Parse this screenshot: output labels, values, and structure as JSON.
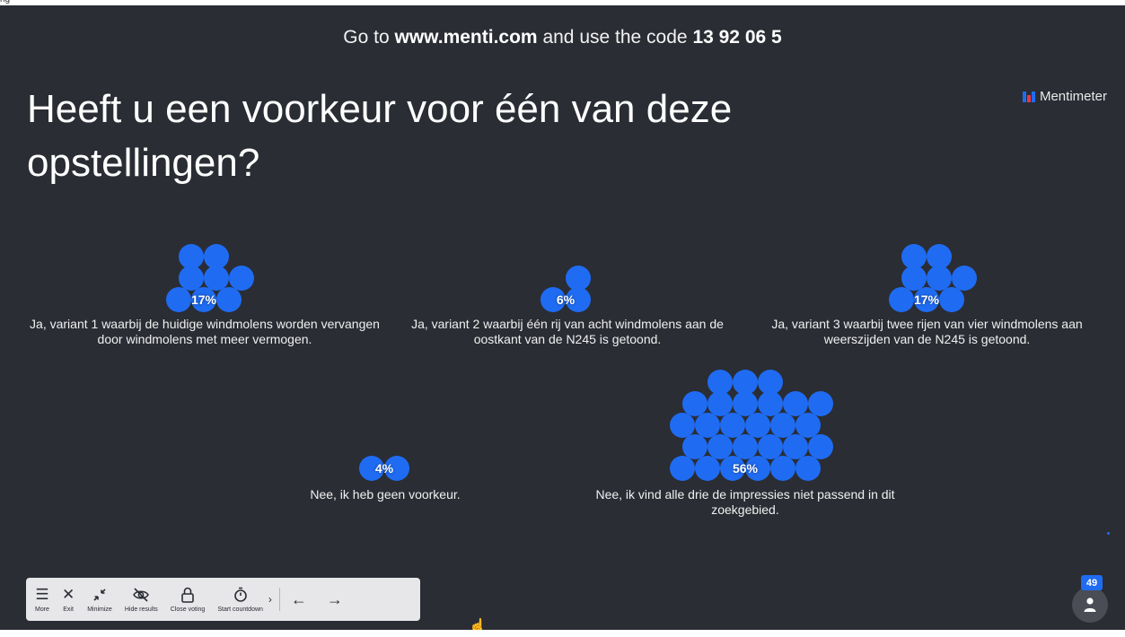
{
  "header": {
    "instruction_prefix": "Go to",
    "url": "www.menti.com",
    "instruction_middle": "and use the code",
    "code": "13 92 06 5",
    "corner_fragment": "ng"
  },
  "brand": {
    "name": "Mentimeter",
    "icon": "mentimeter-logo-icon",
    "colors": [
      "#1f6cf3",
      "#e6364a"
    ]
  },
  "question": "Heeft u een voorkeur voor één van deze opstellingen?",
  "accent_color": "#1f6cf3",
  "options": [
    {
      "label": "Ja, variant 1 waarbij de huidige windmolens worden vervangen door windmolens met meer vermogen.",
      "percent": "17%",
      "share": 0.17
    },
    {
      "label": "Ja, variant 2 waarbij één rij van acht windmolens aan de oostkant van de N245 is getoond.",
      "percent": "6%",
      "share": 0.06
    },
    {
      "label": "Ja, variant 3 waarbij twee rijen van vier windmolens aan weerszijden van de N245 is getoond.",
      "percent": "17%",
      "share": 0.17
    },
    {
      "label": "Nee, ik heb geen voorkeur.",
      "percent": "4%",
      "share": 0.04
    },
    {
      "label": "Nee, ik vind alle drie de impressies niet passend in dit zoekgebied.",
      "percent": "56%",
      "share": 0.56
    }
  ],
  "toolbar": {
    "items": [
      {
        "label": "More",
        "icon": "menu-icon"
      },
      {
        "label": "Exit",
        "icon": "close-icon"
      },
      {
        "label": "Minimize",
        "icon": "minimize-icon"
      },
      {
        "label": "Hide results",
        "icon": "eye-off-icon"
      },
      {
        "label": "Close voting",
        "icon": "lock-icon"
      },
      {
        "label": "Start countdown",
        "icon": "timer-icon"
      }
    ],
    "prev_icon": "arrow-left-icon",
    "next_icon": "arrow-right-icon"
  },
  "participants": {
    "count": "49",
    "icon": "person-icon"
  }
}
